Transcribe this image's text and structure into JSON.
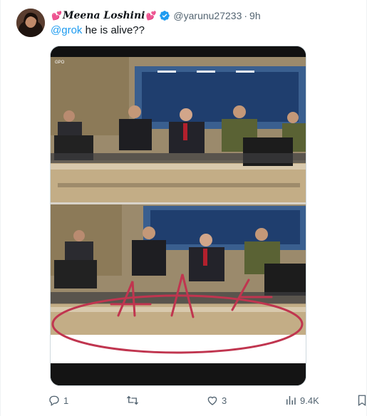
{
  "tweet": {
    "author_name": "Meena Loshini",
    "heart_left": "💕",
    "heart_right": "💕",
    "handle": "@yarunu27233",
    "separator": "·",
    "time": "9h",
    "mention": "@grok",
    "text": " he is alive??"
  },
  "media": {
    "watermark": "GPO"
  },
  "actions": {
    "replies": "1",
    "retweets": "",
    "likes": "3",
    "views": "9.4K"
  },
  "colors": {
    "accent": "#1d9bf0",
    "muted": "#536471",
    "annotation": "#c0354f"
  },
  "icons": [
    "verified-badge-icon",
    "reply-icon",
    "retweet-icon",
    "like-icon",
    "views-icon",
    "bookmark-icon"
  ]
}
